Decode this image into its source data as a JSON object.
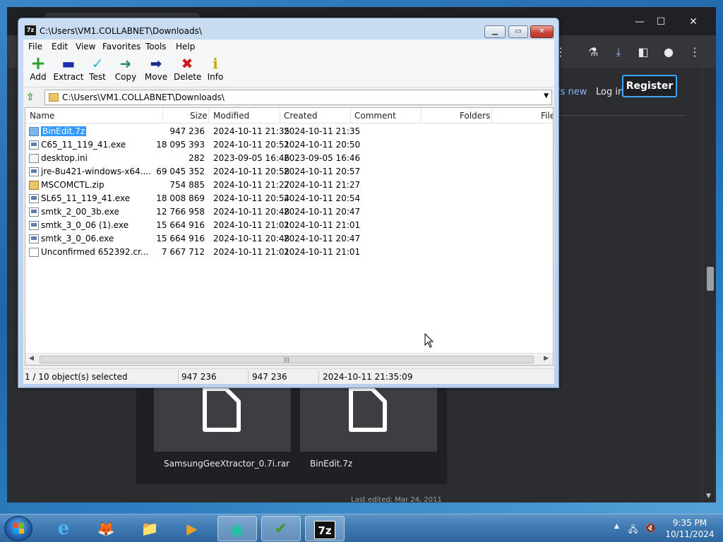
{
  "browser": {
    "window_controls": {
      "minimize": "—",
      "maximize": "☐",
      "close": "✕"
    },
    "nav": {
      "whats_new_partial": "'s new",
      "login": "Log in",
      "register": "Register"
    },
    "tiles": [
      {
        "label": "SamsungGeeXtractor_0.7i.rar"
      },
      {
        "label": "BinEdit.7z"
      }
    ],
    "last_edited": "Last edited: Mar 24, 2011"
  },
  "sevenzip": {
    "title": "C:\\Users\\VM1.COLLABNET\\Downloads\\",
    "title_icon": "7z",
    "menu": [
      "File",
      "Edit",
      "View",
      "Favorites",
      "Tools",
      "Help"
    ],
    "toolbar": [
      {
        "label": "Add",
        "icon": "plus-icon",
        "glyph": "+",
        "color": "#2aa12a"
      },
      {
        "label": "Extract",
        "icon": "minus-icon",
        "glyph": "▬",
        "color": "#1d2fa8"
      },
      {
        "label": "Test",
        "icon": "check-icon",
        "glyph": "✓",
        "color": "#2ab7c9"
      },
      {
        "label": "Copy",
        "icon": "double-arrow-icon",
        "glyph": "➜",
        "color": "#2e8c6e"
      },
      {
        "label": "Move",
        "icon": "arrow-right-icon",
        "glyph": "➡",
        "color": "#1a2b8c"
      },
      {
        "label": "Delete",
        "icon": "x-icon",
        "glyph": "✖",
        "color": "#d21a1a"
      },
      {
        "label": "Info",
        "icon": "info-icon",
        "glyph": "ℹ",
        "color": "#c9a400"
      }
    ],
    "address": "C:\\Users\\VM1.COLLABNET\\Downloads\\",
    "columns": [
      "Name",
      "Size",
      "Modified",
      "Created",
      "Comment",
      "Folders",
      "File"
    ],
    "files": [
      {
        "name": "BinEdit.7z",
        "size": "947 236",
        "modified": "2024-10-11 21:35",
        "created": "2024-10-11 21:35",
        "type": "7z",
        "selected": true
      },
      {
        "name": "C65_11_119_41.exe",
        "size": "18 095 393",
        "modified": "2024-10-11 20:51",
        "created": "2024-10-11 20:50",
        "type": "exe",
        "selected": false
      },
      {
        "name": "desktop.ini",
        "size": "282",
        "modified": "2023-09-05 16:46",
        "created": "2023-09-05 16:46",
        "type": "ini",
        "selected": false
      },
      {
        "name": "jre-8u421-windows-x64....",
        "size": "69 045 352",
        "modified": "2024-10-11 20:58",
        "created": "2024-10-11 20:57",
        "type": "exe",
        "selected": false
      },
      {
        "name": "MSCOMCTL.zip",
        "size": "754 885",
        "modified": "2024-10-11 21:27",
        "created": "2024-10-11 21:27",
        "type": "zip",
        "selected": false
      },
      {
        "name": "SL65_11_119_41.exe",
        "size": "18 008 869",
        "modified": "2024-10-11 20:54",
        "created": "2024-10-11 20:54",
        "type": "exe",
        "selected": false
      },
      {
        "name": "smtk_2_00_3b.exe",
        "size": "12 766 958",
        "modified": "2024-10-11 20:48",
        "created": "2024-10-11 20:47",
        "type": "exe",
        "selected": false
      },
      {
        "name": "smtk_3_0_06 (1).exe",
        "size": "15 664 916",
        "modified": "2024-10-11 21:01",
        "created": "2024-10-11 21:01",
        "type": "exe",
        "selected": false
      },
      {
        "name": "smtk_3_0_06.exe",
        "size": "15 664 916",
        "modified": "2024-10-11 20:48",
        "created": "2024-10-11 20:47",
        "type": "exe",
        "selected": false
      },
      {
        "name": "Unconfirmed 652392.cr...",
        "size": "7 667 712",
        "modified": "2024-10-11 21:01",
        "created": "2024-10-11 21:01",
        "type": "file",
        "selected": false
      }
    ],
    "status": {
      "selection": "1 / 10 object(s) selected",
      "size": "947 236",
      "packed": "947 236",
      "date": "2024-10-11 21:35:09"
    }
  },
  "taskbar": {
    "apps": [
      {
        "name": "internet-explorer",
        "glyph": "e"
      },
      {
        "name": "firefox",
        "glyph": "🦊"
      },
      {
        "name": "file-explorer",
        "glyph": "📁"
      },
      {
        "name": "media-player",
        "glyph": "▶"
      },
      {
        "name": "app-green",
        "glyph": "◉"
      },
      {
        "name": "app-checklist",
        "glyph": "✔"
      },
      {
        "name": "7zip",
        "glyph": "7z"
      }
    ],
    "time": "9:35 PM",
    "date": "10/11/2024"
  }
}
